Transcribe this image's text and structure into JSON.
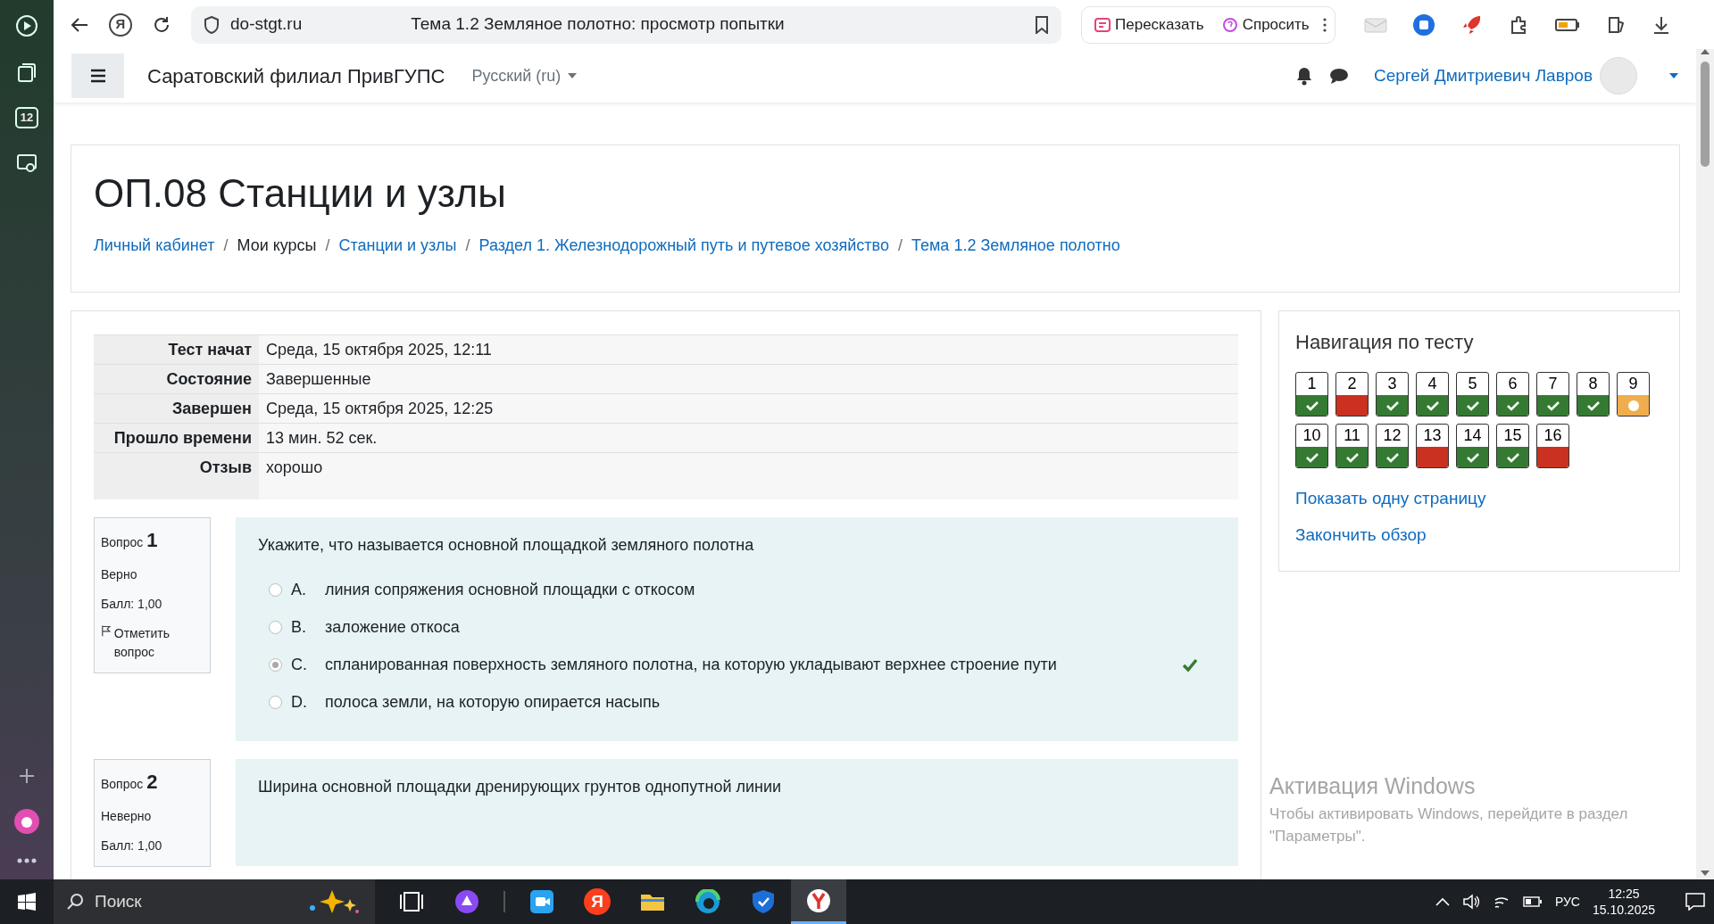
{
  "browser": {
    "logo_letter": "Я",
    "address": "do-stgt.ru",
    "tab_title": "Тема 1.2 Земляное полотно: просмотр попытки",
    "actions": [
      "Пересказать",
      "Спросить"
    ],
    "sidebar_badge": "12"
  },
  "site_header": {
    "site_name": "Саратовский филиал ПривГУПС",
    "language": "Русский (ru)",
    "user_name": "Сергей Дмитриевич Лавров"
  },
  "course": {
    "title": "ОП.08 Станции и узлы",
    "breadcrumb": [
      {
        "kind": "link",
        "label": "Личный кабинет"
      },
      {
        "kind": "separator",
        "label": "/"
      },
      {
        "kind": "text",
        "label": "Мои курсы"
      },
      {
        "kind": "separator",
        "label": "/"
      },
      {
        "kind": "link",
        "label": "Станции и узлы"
      },
      {
        "kind": "separator",
        "label": "/"
      },
      {
        "kind": "link",
        "label": "Раздел 1. Железнодорожный путь и путевое хозяйство"
      },
      {
        "kind": "separator",
        "label": "/"
      },
      {
        "kind": "link",
        "label": "Тема 1.2 Земляное полотно"
      }
    ]
  },
  "summary": [
    {
      "label": "Тест начат",
      "value": "Среда, 15 октября 2025, 12:11"
    },
    {
      "label": "Состояние",
      "value": "Завершенные"
    },
    {
      "label": "Завершен",
      "value": "Среда, 15 октября 2025, 12:25"
    },
    {
      "label": "Прошло времени",
      "value": "13 мин. 52 сек."
    },
    {
      "label": "Отзыв",
      "value": "хорошо"
    }
  ],
  "questions": [
    {
      "number": "Вопрос **1**",
      "status": "Верно",
      "grade": "Балл: 1,00",
      "flag": "Отметить вопрос",
      "text": "Укажите, что называется основной площадкой земляного полотна",
      "options": [
        {
          "letter": "A.",
          "text": "линия сопряжения основной площадки с откосом",
          "selected": false,
          "correct": false
        },
        {
          "letter": "B.",
          "text": "заложение откоса",
          "selected": false,
          "correct": false
        },
        {
          "letter": "C.",
          "text": "спланированная поверхность земляного полотна, на которую укладывают верхнее строение пути",
          "selected": true,
          "correct": true
        },
        {
          "letter": "D.",
          "text": "полоса земли, на которую опирается насыпь",
          "selected": false,
          "correct": false
        }
      ]
    },
    {
      "number": "Вопрос **2**",
      "status": "Неверно",
      "grade": "Балл: 1,00",
      "text": "Ширина основной площадки дренирующих грунтов однопутной линии"
    }
  ],
  "quiz_nav": {
    "title": "Навигация по тесту",
    "buttons": [
      {
        "label": "1",
        "kind": "correct"
      },
      {
        "label": "2",
        "kind": "incorrect"
      },
      {
        "label": "3",
        "kind": "correct"
      },
      {
        "label": "4",
        "kind": "correct"
      },
      {
        "label": "5",
        "kind": "correct"
      },
      {
        "label": "6",
        "kind": "correct"
      },
      {
        "label": "7",
        "kind": "correct"
      },
      {
        "label": "8",
        "kind": "correct"
      },
      {
        "label": "9",
        "kind": "partial"
      },
      {
        "label": "10",
        "kind": "correct"
      },
      {
        "label": "11",
        "kind": "correct"
      },
      {
        "label": "12",
        "kind": "correct"
      },
      {
        "label": "13",
        "kind": "incorrect"
      },
      {
        "label": "14",
        "kind": "correct"
      },
      {
        "label": "15",
        "kind": "correct"
      },
      {
        "label": "16",
        "kind": "incorrect"
      }
    ],
    "links": [
      "Показать одну страницу",
      "Закончить обзор"
    ]
  },
  "activation": {
    "title": "Активация Windows",
    "text": "Чтобы активировать Windows, перейдите в раздел \"Параметры\"."
  },
  "taskbar": {
    "search_placeholder": "Поиск",
    "yandex_letter": "Я",
    "language": "РУС",
    "time": "12:25",
    "date": "15.10.2025"
  }
}
